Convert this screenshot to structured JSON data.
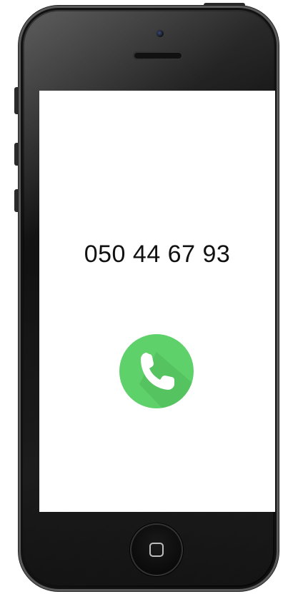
{
  "device": {
    "type": "smartphone"
  },
  "screen": {
    "phone_number": "050 44 67 93",
    "call_button": {
      "icon": "phone-icon",
      "color": "#5fd16a"
    }
  },
  "colors": {
    "screen_background": "#ffffff",
    "call_green": "#5fd16a",
    "text": "#111111"
  }
}
